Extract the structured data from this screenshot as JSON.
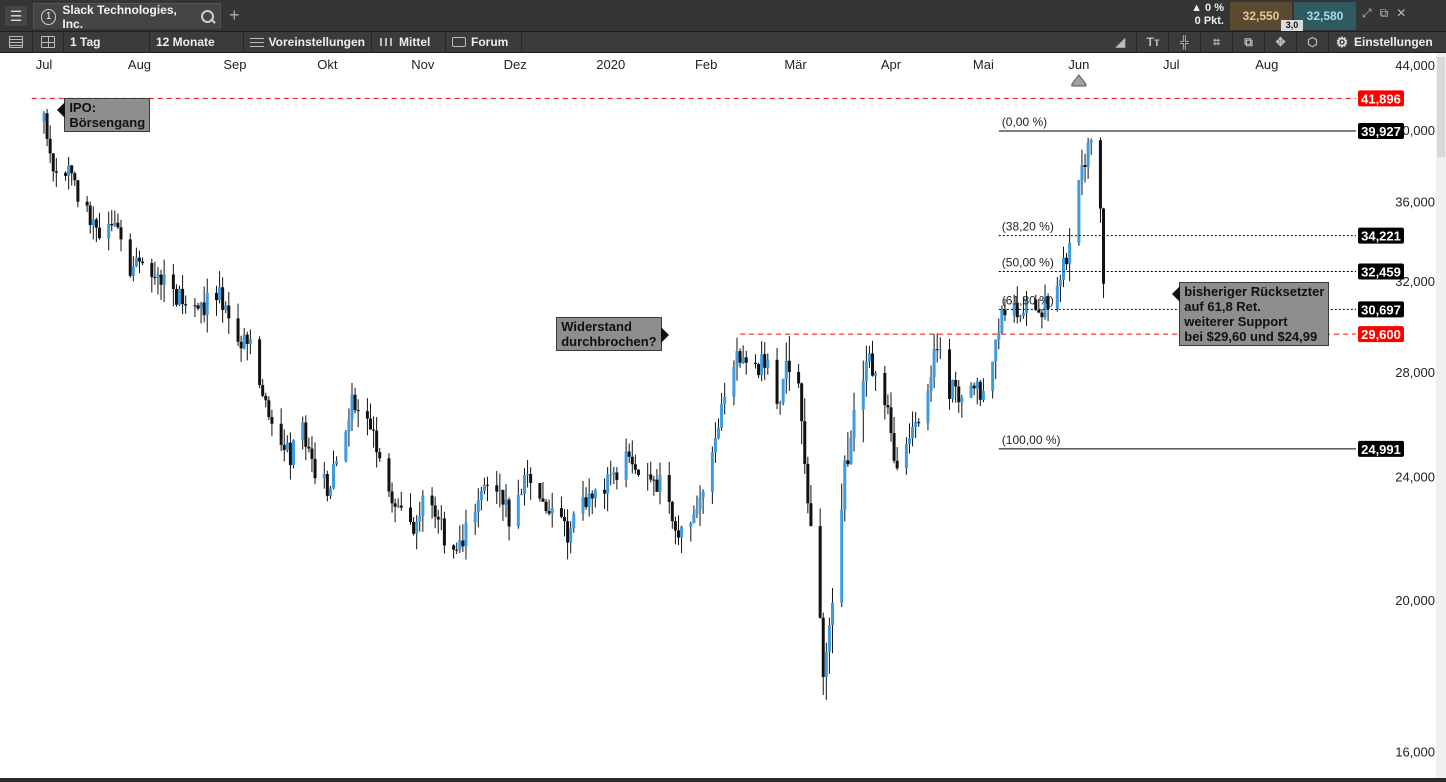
{
  "topbar": {
    "menu_icon": "hamburger-menu-icon",
    "tab_number": "1",
    "instrument": "Slack Technologies, Inc.",
    "search_icon": "search-icon",
    "add_tab_icon": "plus-icon",
    "add_tab_symbol": "+",
    "change_pct": "▲ 0 %",
    "change_pts": "0 Pkt.",
    "bid": "32,550",
    "ask": "32,580",
    "spread": "3,0",
    "bid_color": "#5a4a32",
    "ask_color": "#2f5a60",
    "window_buttons": [
      "⤢",
      "⧉",
      "✕"
    ]
  },
  "toolbar": {
    "interval": "1 Tag",
    "range": "12 Monate",
    "presets": "Voreinstellungen",
    "style": "Mittel",
    "forum": "Forum",
    "tool_icons": [
      "◢",
      "Tᴛ",
      "╬",
      "⌗",
      "⧉",
      "✥",
      "⬡"
    ],
    "settings": "Einstellungen"
  },
  "chart_data": {
    "type": "candlestick",
    "scale": "log",
    "ylim": [
      15500,
      44400
    ],
    "y_ticks": [
      "16,000",
      "20,000",
      "24,000",
      "28,000",
      "32,000",
      "36,000",
      "40,000",
      "44,000"
    ],
    "y_tick_values": [
      16000,
      20000,
      24000,
      28000,
      32000,
      36000,
      40000,
      44000
    ],
    "x_labels": [
      "Jul",
      "Aug",
      "Sep",
      "Okt",
      "Nov",
      "Dez",
      "2020",
      "Feb",
      "Mär",
      "Apr",
      "Mai",
      "Jun",
      "Jul",
      "Aug"
    ],
    "x_label_days": [
      0,
      31,
      62,
      92,
      123,
      153,
      184,
      215,
      244,
      275,
      305,
      336,
      366,
      397
    ],
    "first_day": -4,
    "last_day": 437,
    "up_color": "#3d9be0",
    "down_color": "#111111",
    "anchors": [
      [
        0,
        40.5
      ],
      [
        4,
        37.0
      ],
      [
        8,
        37.5
      ],
      [
        12,
        35.8
      ],
      [
        18,
        34.2
      ],
      [
        24,
        34.5
      ],
      [
        28,
        31.8
      ],
      [
        32,
        33.3
      ],
      [
        38,
        32.1
      ],
      [
        44,
        31.3
      ],
      [
        50,
        30.6
      ],
      [
        55,
        31.5
      ],
      [
        60,
        30.8
      ],
      [
        63,
        29.2
      ],
      [
        66,
        29.5
      ],
      [
        72,
        26.8
      ],
      [
        76,
        25.6
      ],
      [
        80,
        24.7
      ],
      [
        84,
        26.0
      ],
      [
        88,
        24.1
      ],
      [
        92,
        23.7
      ],
      [
        96,
        24.8
      ],
      [
        100,
        26.6
      ],
      [
        104,
        25.9
      ],
      [
        108,
        25.2
      ],
      [
        112,
        23.6
      ],
      [
        116,
        22.7
      ],
      [
        120,
        22.1
      ],
      [
        124,
        23.3
      ],
      [
        128,
        22.6
      ],
      [
        132,
        21.5
      ],
      [
        136,
        21.9
      ],
      [
        140,
        22.8
      ],
      [
        144,
        23.6
      ],
      [
        148,
        23.3
      ],
      [
        152,
        22.5
      ],
      [
        156,
        23.7
      ],
      [
        160,
        23.9
      ],
      [
        165,
        22.7
      ],
      [
        170,
        22.1
      ],
      [
        175,
        23.0
      ],
      [
        180,
        23.5
      ],
      [
        186,
        24.3
      ],
      [
        190,
        24.8
      ],
      [
        194,
        24.0
      ],
      [
        198,
        24.1
      ],
      [
        204,
        22.7
      ],
      [
        208,
        21.9
      ],
      [
        211,
        22.3
      ],
      [
        215,
        24.0
      ],
      [
        219,
        25.9
      ],
      [
        222,
        28.0
      ],
      [
        226,
        28.5
      ],
      [
        230,
        27.8
      ],
      [
        234,
        28.4
      ],
      [
        238,
        26.8
      ],
      [
        242,
        28.5
      ],
      [
        245,
        27.1
      ],
      [
        248,
        23.5
      ],
      [
        251,
        20.5
      ],
      [
        253,
        17.6
      ],
      [
        256,
        19.8
      ],
      [
        259,
        23.1
      ],
      [
        262,
        25.9
      ],
      [
        265,
        27.7
      ],
      [
        268,
        29.2
      ],
      [
        271,
        27.6
      ],
      [
        274,
        26.2
      ],
      [
        277,
        24.2
      ],
      [
        280,
        25.3
      ],
      [
        284,
        26.2
      ],
      [
        287,
        27.7
      ],
      [
        290,
        29.0
      ],
      [
        293,
        27.5
      ],
      [
        296,
        27.1
      ],
      [
        299,
        26.9
      ],
      [
        302,
        27.4
      ],
      [
        305,
        26.9
      ],
      [
        308,
        28.3
      ],
      [
        311,
        30.7
      ],
      [
        314,
        31.2
      ],
      [
        317,
        30.4
      ],
      [
        320,
        31.7
      ],
      [
        323,
        30.3
      ],
      [
        326,
        31.1
      ],
      [
        329,
        32.1
      ],
      [
        332,
        32.9
      ],
      [
        334,
        35.4
      ],
      [
        336,
        37.0
      ],
      [
        338,
        38.2
      ],
      [
        340,
        39.5
      ],
      [
        342,
        38.7
      ],
      [
        344,
        32.0
      ]
    ],
    "levels": [
      {
        "value": 41.896,
        "label": "41,896",
        "kind": "ipo",
        "style": "red-dashed"
      },
      {
        "value": 39.927,
        "label": "39,927",
        "kind": "fib",
        "pct": "(0,00 %)",
        "style": "solid"
      },
      {
        "value": 34.221,
        "label": "34,221",
        "kind": "fib",
        "pct": "(38,20 %)",
        "style": "dotted"
      },
      {
        "value": 32.459,
        "label": "32,459",
        "kind": "fib",
        "pct": "(50,00 %)",
        "style": "dotted"
      },
      {
        "value": 30.697,
        "label": "30,697",
        "kind": "fib",
        "pct": "(61,80 %)",
        "style": "dotted"
      },
      {
        "value": 29.6,
        "label": "29,600",
        "kind": "support",
        "style": "red-dashed"
      },
      {
        "value": 24.991,
        "label": "24,991",
        "kind": "fib",
        "pct": "(100,00 %)",
        "style": "solid"
      }
    ],
    "fib_start_day": 310,
    "ipo_line_start_day": -4,
    "support_line_start_day": 226,
    "annotations": [
      {
        "lines": [
          "IPO:",
          "Börsengang"
        ],
        "day": 4,
        "value": 41.3,
        "pointer": "left"
      },
      {
        "lines": [
          "Widerstand",
          "durchbrochen?"
        ],
        "day": 203,
        "value": 29.6,
        "pointer": "right"
      },
      {
        "lines": [
          "bisheriger Rücksetzter",
          "auf 61,8 Ret.",
          "weiterer Support",
          "bei $29,60 und $24,99"
        ],
        "day": 366,
        "value": 31.5,
        "pointer": "left"
      }
    ],
    "today_marker_day": 336,
    "colors": {
      "red_level": "#ff0000",
      "black_level": "#000000",
      "grid": "none"
    }
  }
}
